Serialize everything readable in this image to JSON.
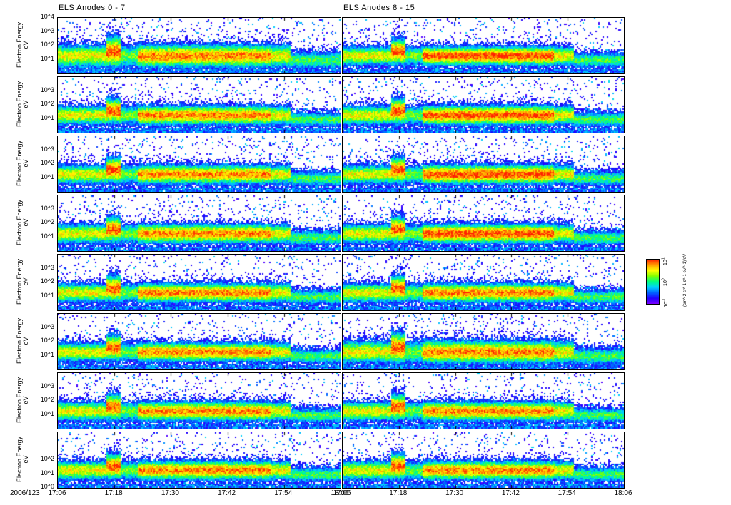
{
  "chart_data": {
    "type": "heatmap",
    "titles": [
      "ELS Anodes 0 - 7",
      "ELS Anodes 8 - 15"
    ],
    "ylabel": "Electron Energy",
    "yunit": "eV",
    "yscale": "log",
    "ylim": [
      1,
      10000
    ],
    "ytick_labels": {
      "top_panel": [
        "10^4",
        "10^3",
        "10^2",
        "10^1"
      ],
      "middle_panels": [
        "10^3",
        "10^2",
        "10^1"
      ],
      "bottom_panel": [
        "10^2",
        "10^1",
        "10^0"
      ]
    },
    "xlim": [
      "17:06",
      "18:06"
    ],
    "date_label": "2006/123",
    "xtick_labels": [
      "17:06",
      "17:18",
      "17:30",
      "17:42",
      "17:54",
      "18:06"
    ],
    "rows": 8,
    "columns": 2,
    "colorbar": {
      "label": "(cm^-2 sr^-1 s^-1 eV^-1)/eV",
      "ticks": [
        "10^-1",
        "10^0",
        "10^1"
      ],
      "colors": [
        "#7a00ff",
        "#2000ff",
        "#00d0ff",
        "#00ff80",
        "#ffff00",
        "#ff2000"
      ]
    }
  }
}
